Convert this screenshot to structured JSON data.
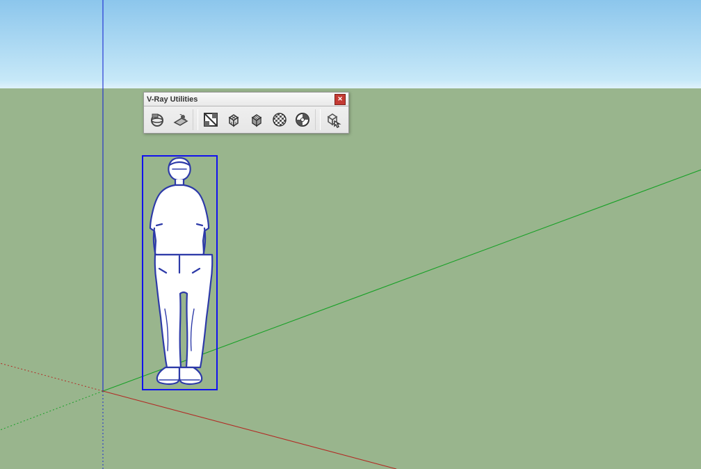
{
  "toolbar": {
    "title": "V-Ray Utilities",
    "close": "✕"
  },
  "icons": {
    "sphere": "vray-sphere-icon",
    "plane": "vray-plane-icon",
    "uv1": "uv-tool-icon",
    "cube1": "cube-wireframe-icon",
    "cube2": "cube-grid-icon",
    "checker": "checker-sphere-icon",
    "disc": "disc-icon",
    "cubehand": "cube-select-icon"
  }
}
